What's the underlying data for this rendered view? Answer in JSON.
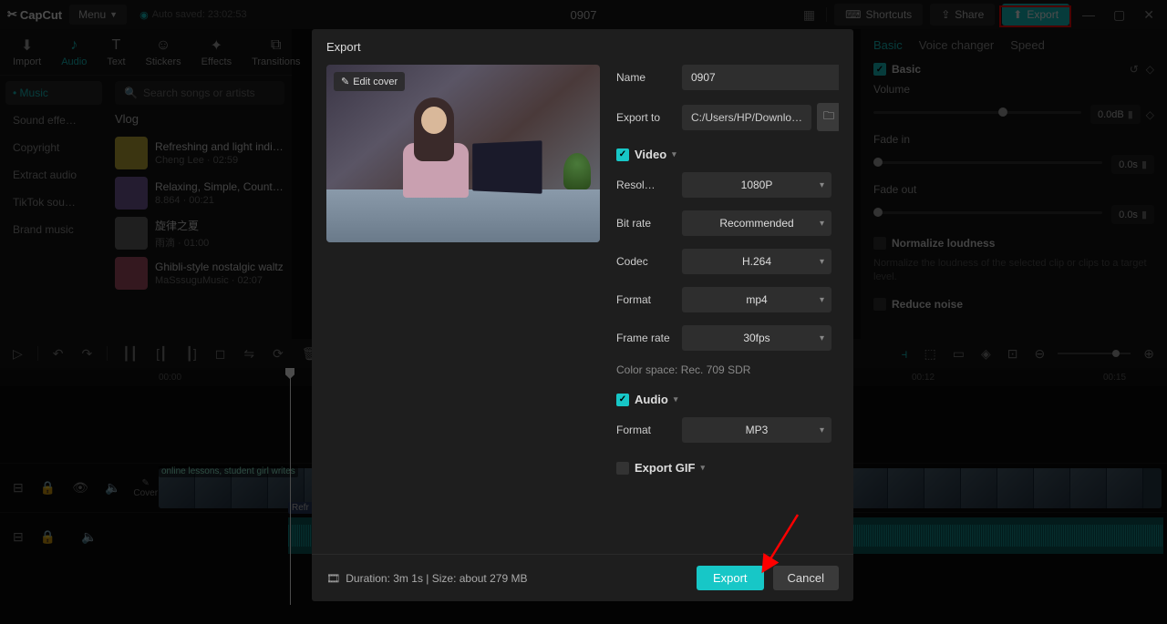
{
  "topbar": {
    "logo": "CapCut",
    "menu": "Menu",
    "autosave": "Auto saved: 23:02:53",
    "title": "0907",
    "shortcuts": "Shortcuts",
    "share": "Share",
    "export": "Export"
  },
  "tabs": [
    "Import",
    "Audio",
    "Text",
    "Stickers",
    "Effects",
    "Transitions"
  ],
  "tabs_active_index": 1,
  "categories": [
    "Music",
    "Sound effe…",
    "Copyright",
    "Extract audio",
    "TikTok sou…",
    "Brand music"
  ],
  "categories_active_index": 0,
  "search_placeholder": "Search songs or artists",
  "section_label": "Vlog",
  "songs": [
    {
      "title": "Refreshing and light indie p…",
      "meta": "Cheng Lee · 02:59",
      "thumb": "#c7b23a"
    },
    {
      "title": "Relaxing, Simple, Countrysid…",
      "meta": "8.864 · 00:21",
      "thumb": "#7a5fa0"
    },
    {
      "title": "旋律之夏",
      "meta": "雨滴 · 01:00",
      "thumb": "#6a6a6a"
    },
    {
      "title": "Ghibli-style nostalgic waltz",
      "meta": "MaSssuguMusic · 02:07",
      "thumb": "#b0506a"
    }
  ],
  "right_panel": {
    "tabs": [
      "Basic",
      "Voice changer",
      "Speed"
    ],
    "active_tab": 0,
    "section": "Basic",
    "volume_label": "Volume",
    "volume_value": "0.0dB",
    "fadein_label": "Fade in",
    "fadein_value": "0.0s",
    "fadeout_label": "Fade out",
    "fadeout_value": "0.0s",
    "normalize_label": "Normalize loudness",
    "normalize_desc": "Normalize the loudness of the selected clip or clips to a target level.",
    "reduce_label": "Reduce noise"
  },
  "timeline": {
    "ticks": [
      "00:00",
      "00:12",
      "00:15"
    ],
    "clip_label": "online lessons, student girl writes",
    "audio_clip": "Refr",
    "cover_label": "Cover"
  },
  "export_modal": {
    "title": "Export",
    "edit_cover": "Edit cover",
    "name_label": "Name",
    "name_value": "0907",
    "exportto_label": "Export to",
    "exportto_value": "C:/Users/HP/Downlo…",
    "video_section": "Video",
    "resolution_label": "Resol…",
    "resolution_value": "1080P",
    "bitrate_label": "Bit rate",
    "bitrate_value": "Recommended",
    "codec_label": "Codec",
    "codec_value": "H.264",
    "format_label": "Format",
    "format_value": "mp4",
    "framerate_label": "Frame rate",
    "framerate_value": "30fps",
    "colorspace": "Color space: Rec. 709 SDR",
    "audio_section": "Audio",
    "audio_format_label": "Format",
    "audio_format_value": "MP3",
    "gif_section": "Export GIF",
    "duration_info": "Duration: 3m 1s | Size: about 279 MB",
    "export_btn": "Export",
    "cancel_btn": "Cancel"
  }
}
